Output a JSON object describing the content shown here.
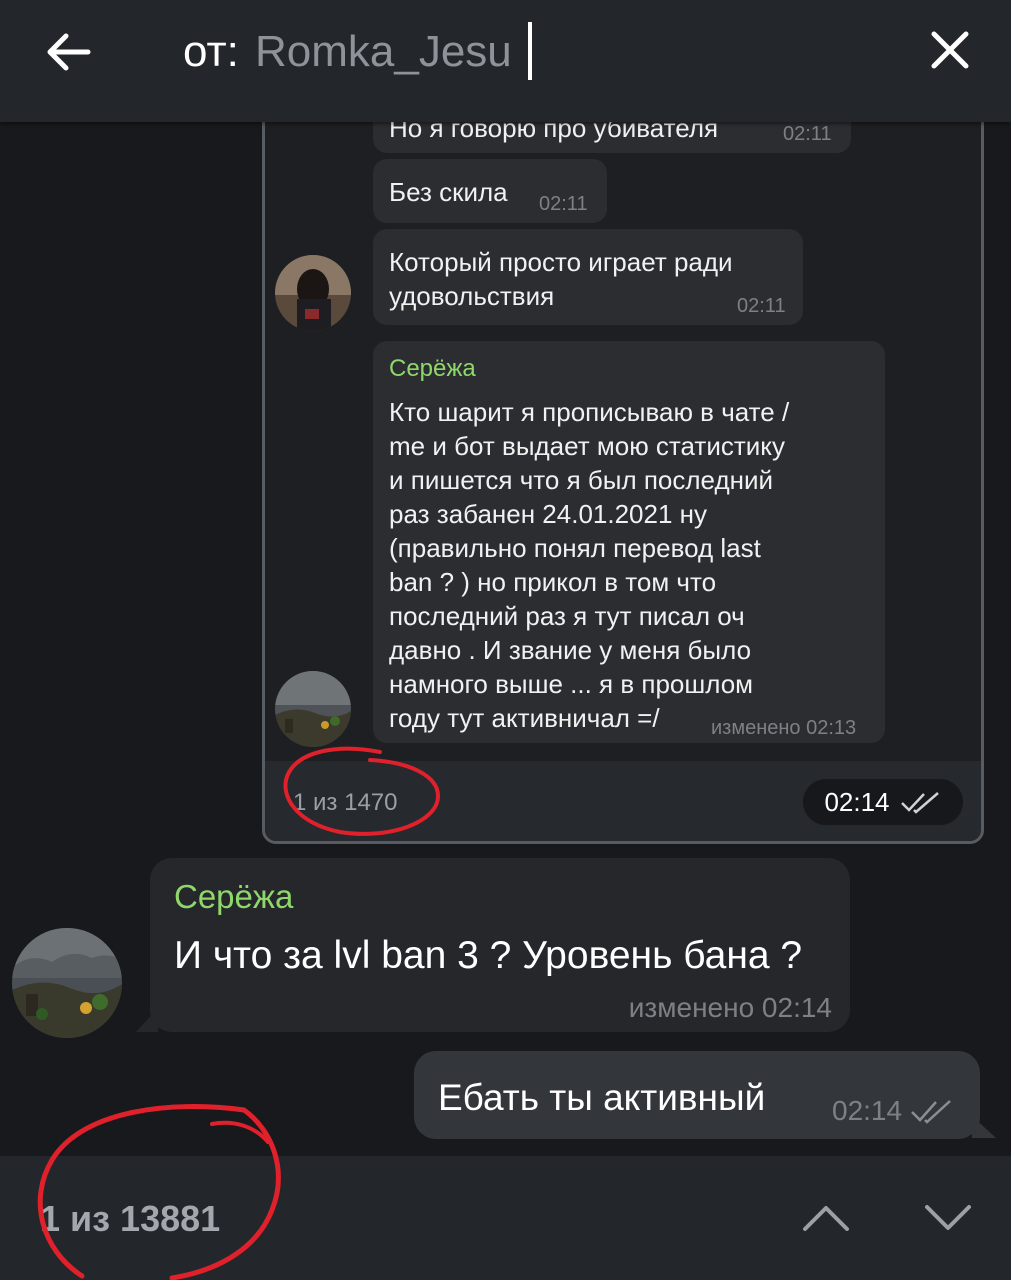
{
  "search": {
    "prefix": "от:",
    "value": "Romka_Jesu",
    "back_icon": "arrow-left-icon",
    "close_icon": "close-icon"
  },
  "preview": {
    "messages": [
      {
        "text": "Но я говорю про убивателя",
        "time": "02:11"
      },
      {
        "text": "Без скила",
        "time": "02:11"
      },
      {
        "lines": [
          "Который просто играет ради",
          "удовольствия"
        ],
        "time": "02:11"
      },
      {
        "sender": "Серёжа",
        "lines": [
          "Кто шарит я прописываю в чате /",
          "me и бот выдает мою статистику",
          "и пишется что я был последний",
          "раз забанен 24.01.2021 ну",
          "(правильно понял перевод last",
          "ban ? ) но прикол в том что",
          "последний раз я тут писал оч",
          "давно . И звание у меня было",
          "намного выше ... я в прошлом",
          "году тут активничал =/"
        ],
        "meta": "изменено 02:13"
      }
    ],
    "counter": "1 из 1470",
    "time_pill": "02:14"
  },
  "chat": {
    "incoming": {
      "sender": "Серёжа",
      "text": "И что за lvl ban 3 ? Уровень бана ?",
      "meta": "изменено 02:14"
    },
    "outgoing": {
      "text": "Ебать ты активный",
      "time": "02:14"
    }
  },
  "bottom": {
    "counter": "1 из 13881",
    "up_icon": "chevron-up-icon",
    "down_icon": "chevron-down-icon"
  },
  "colors": {
    "accent_green": "#8fd76a",
    "background": "#17191c",
    "annotation_red": "#e0212b"
  }
}
